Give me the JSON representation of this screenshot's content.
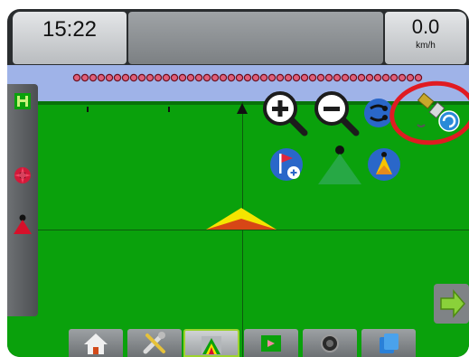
{
  "header": {
    "clock": "15:22",
    "speed_value": "0.0",
    "speed_unit": "km/h"
  },
  "map_tools": {
    "zoom_in": "zoom-in",
    "zoom_out": "zoom-out",
    "view_toggle": "view-toggle",
    "gnss_status": "gnss-satellite-status",
    "add_marker": "add-marker",
    "vehicle_view": "vehicle-view",
    "perspective": "perspective-view"
  },
  "bottom_tabs": [
    "home",
    "setup-tools",
    "guidance",
    "field-map",
    "camera",
    "data-export"
  ],
  "active_tab": "guidance",
  "colors": {
    "field": "#0aa10c",
    "sky": "#9fb3e8",
    "vehicle": "#f5e400",
    "annotation": "#e01b22"
  }
}
